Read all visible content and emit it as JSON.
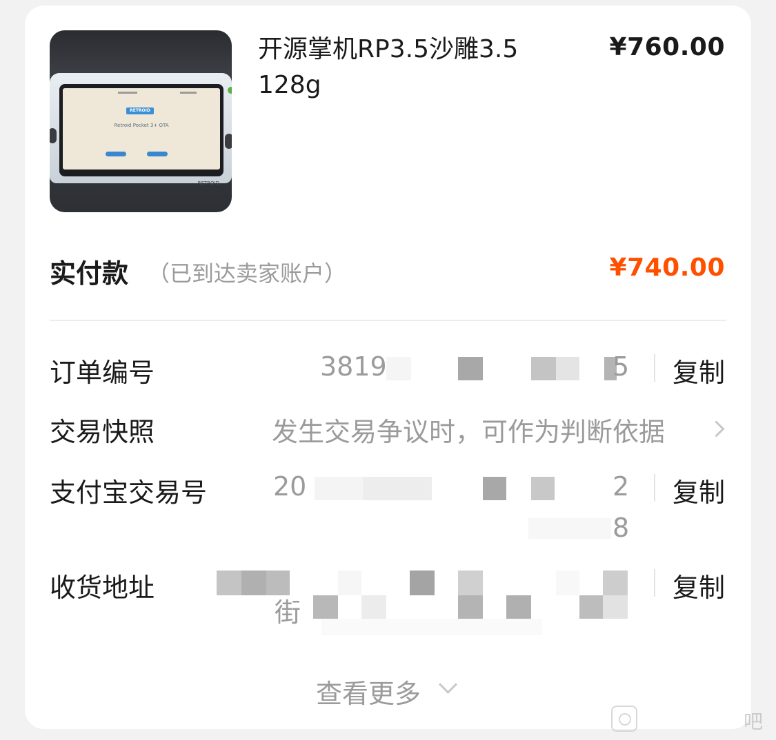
{
  "product": {
    "title": "开源掌机RP3.5沙雕3.5 128g",
    "price": "¥760.00",
    "image_brand_text": "RETROID",
    "image_screen_text": "Retroid Pocket 3+ OTA"
  },
  "payment": {
    "label": "实付款",
    "note": "（已到达卖家账户）",
    "amount": "¥740.00",
    "amount_color": "#ff5000"
  },
  "details": {
    "order_number": {
      "label": "订单编号",
      "visible_fragments": [
        "3819",
        "5"
      ],
      "copy_label": "复制"
    },
    "snapshot": {
      "label": "交易快照",
      "value": "发生交易争议时，可作为判断依据"
    },
    "alipay_number": {
      "label": "支付宝交易号",
      "visible_fragments": [
        "20",
        "2",
        "8"
      ],
      "copy_label": "复制"
    },
    "address": {
      "label": "收货地址",
      "visible_fragments": [
        "街"
      ],
      "copy_label": "复制"
    }
  },
  "footer": {
    "more_label": "查看更多"
  },
  "watermark": {
    "text": "吧"
  },
  "icons": [
    "chevron-right-icon",
    "chevron-down-icon",
    "watermark-logo-icon"
  ]
}
